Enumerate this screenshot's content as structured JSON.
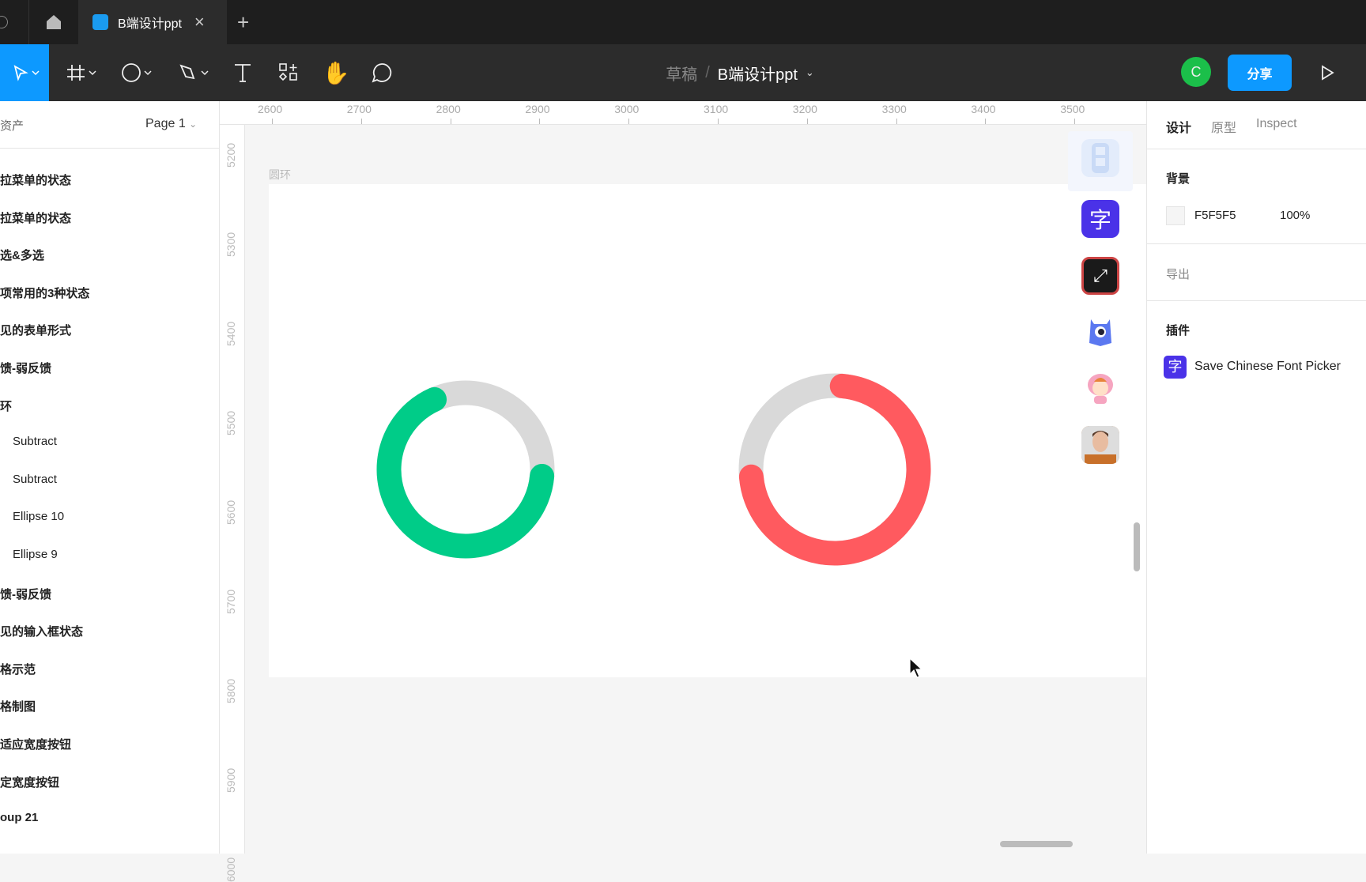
{
  "tabbar": {
    "tab_title": "B端设计ppt",
    "close": "×",
    "new_tab": "+"
  },
  "toolbar": {
    "breadcrumb_parent": "草稿",
    "separator": "/",
    "file_name": "B端设计ppt",
    "avatar_letter": "C",
    "share_label": "分享",
    "accent": "#0d99ff"
  },
  "left_panel": {
    "assets_label": "资产",
    "page_label": "Page 1",
    "layers": [
      {
        "label": "拉菜单的状态",
        "child": false
      },
      {
        "label": "拉菜单的状态",
        "child": false
      },
      {
        "label": "选&多选",
        "child": false
      },
      {
        "label": "项常用的3种状态",
        "child": false
      },
      {
        "label": "见的表单形式",
        "child": false
      },
      {
        "label": "馈-弱反馈",
        "child": false
      },
      {
        "label": "环",
        "child": false
      },
      {
        "label": "Subtract",
        "child": true
      },
      {
        "label": "Subtract",
        "child": true
      },
      {
        "label": "Ellipse 10",
        "child": true
      },
      {
        "label": "Ellipse 9",
        "child": true
      },
      {
        "label": "馈-弱反馈",
        "child": false
      },
      {
        "label": "见的输入框状态",
        "child": false
      },
      {
        "label": "格示范",
        "child": false
      },
      {
        "label": "格制图",
        "child": false
      },
      {
        "label": "适应宽度按钮",
        "child": false
      },
      {
        "label": "定宽度按钮",
        "child": false
      },
      {
        "label": "oup 21",
        "child": false
      }
    ]
  },
  "rulers": {
    "top": [
      "2600",
      "2700",
      "2800",
      "2900",
      "3000",
      "3100",
      "3200",
      "3300",
      "3400",
      "3500"
    ],
    "left": [
      "5200",
      "5300",
      "5400",
      "5500",
      "5600",
      "5700",
      "5800",
      "5900",
      "6000"
    ]
  },
  "canvas": {
    "frame_label": "圆环",
    "rings": [
      {
        "color": "#00cc88",
        "track": "#d9d9d9",
        "arc_start_deg": 95,
        "arc_end_deg": 336
      },
      {
        "color": "#ff5a5f",
        "track": "#d9d9d9",
        "arc_start_deg": 5,
        "arc_end_deg": 265
      }
    ]
  },
  "plugins_bar": [
    {
      "icon": "layout-plugin-icon"
    },
    {
      "icon": "font-picker-plugin-icon",
      "glyph": "字"
    },
    {
      "icon": "resize-plugin-icon",
      "glyph": "⤢"
    },
    {
      "icon": "monster-plugin-icon"
    },
    {
      "icon": "pig-avatar-plugin-icon"
    },
    {
      "icon": "portrait-plugin-icon"
    }
  ],
  "right_panel": {
    "tabs": [
      "设计",
      "原型",
      "Inspect"
    ],
    "background_label": "背景",
    "bg_color": "F5F5F5",
    "bg_opacity": "100%",
    "export_label": "导出",
    "plugins_label": "插件",
    "plugin_name": "Save Chinese Font Picker",
    "plugin_glyph": "字"
  }
}
